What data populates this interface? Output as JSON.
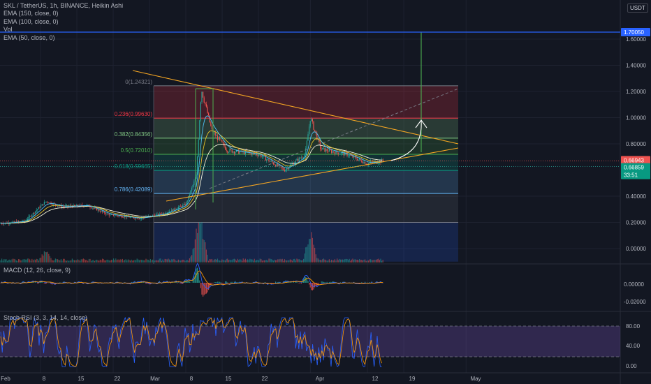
{
  "header": {
    "symbol_line": "SKL / TetherUS, 1h, BINANCE, Heikin Ashi",
    "indicators": [
      "EMA (150, close, 0)",
      "EMA (100, close, 0)",
      "Vol",
      "EMA (50, close, 0)"
    ],
    "currency": "USDT"
  },
  "price_axis": {
    "ticks": [
      "1.60000",
      "1.40000",
      "1.20000",
      "1.00000",
      "0.80000",
      "0.40000",
      "0.20000",
      "0.00000"
    ],
    "target_label": "1.70050",
    "last_price_label": "0.66943",
    "ema_label": "0.66859",
    "countdown_label": "33:51"
  },
  "time_axis": {
    "ticks": [
      "Feb",
      "8",
      "15",
      "22",
      "Mar",
      "8",
      "15",
      "22",
      "Apr",
      "12",
      "19",
      "May"
    ]
  },
  "fib_levels": [
    {
      "label": "0(1.24321)",
      "value": 1.24321,
      "color": "#787b86"
    },
    {
      "label": "0.236(0.99630)",
      "value": 0.9963,
      "color": "#f23645"
    },
    {
      "label": "0.382(0.84356)",
      "value": 0.84356,
      "color": "#81c784"
    },
    {
      "label": "0.5(0.72010)",
      "value": 0.7201,
      "color": "#4caf50"
    },
    {
      "label": "0.618(0.59665)",
      "value": 0.59665,
      "color": "#089981"
    },
    {
      "label": "0.786(0.42089)",
      "value": 0.42089,
      "color": "#64b5f6"
    }
  ],
  "macd": {
    "label": "MACD (12, 26, close, 9)",
    "ticks": [
      "0.00000",
      "-0.02000"
    ]
  },
  "stoch": {
    "label": "Stoch RSI (3, 3, 14, 14, close)",
    "ticks": [
      "80.00",
      "40.00",
      "0.00"
    ]
  },
  "chart_data": {
    "type": "candlestick",
    "symbol": "SKL/USDT",
    "interval": "1h",
    "x_range": [
      "2021-01-31",
      "2021-05-10"
    ],
    "ylim": [
      -0.05,
      1.75
    ],
    "price_path": [
      {
        "date": "2021-01-31",
        "price": 0.19
      },
      {
        "date": "2021-02-05",
        "price": 0.21
      },
      {
        "date": "2021-02-09",
        "price": 0.36
      },
      {
        "date": "2021-02-12",
        "price": 0.32
      },
      {
        "date": "2021-02-17",
        "price": 0.33
      },
      {
        "date": "2021-02-21",
        "price": 0.26
      },
      {
        "date": "2021-02-27",
        "price": 0.23
      },
      {
        "date": "2021-03-04",
        "price": 0.27
      },
      {
        "date": "2021-03-08",
        "price": 0.34
      },
      {
        "date": "2021-03-10",
        "price": 0.55
      },
      {
        "date": "2021-03-11",
        "price": 1.22
      },
      {
        "date": "2021-03-13",
        "price": 0.9
      },
      {
        "date": "2021-03-16",
        "price": 0.75
      },
      {
        "date": "2021-03-22",
        "price": 0.72
      },
      {
        "date": "2021-03-27",
        "price": 0.6
      },
      {
        "date": "2021-03-31",
        "price": 0.72
      },
      {
        "date": "2021-04-01",
        "price": 1.0
      },
      {
        "date": "2021-04-03",
        "price": 0.76
      },
      {
        "date": "2021-04-08",
        "price": 0.72
      },
      {
        "date": "2021-04-12",
        "price": 0.65
      },
      {
        "date": "2021-04-15",
        "price": 0.67
      }
    ],
    "volume_path": [
      {
        "date": "2021-02-09",
        "volume": 0.3
      },
      {
        "date": "2021-03-10",
        "volume": 0.55
      },
      {
        "date": "2021-03-11",
        "volume": 1.0
      },
      {
        "date": "2021-04-01",
        "volume": 0.9
      }
    ],
    "target_price": 1.7005,
    "last_price": 0.66943,
    "ema_value": 0.66859
  }
}
